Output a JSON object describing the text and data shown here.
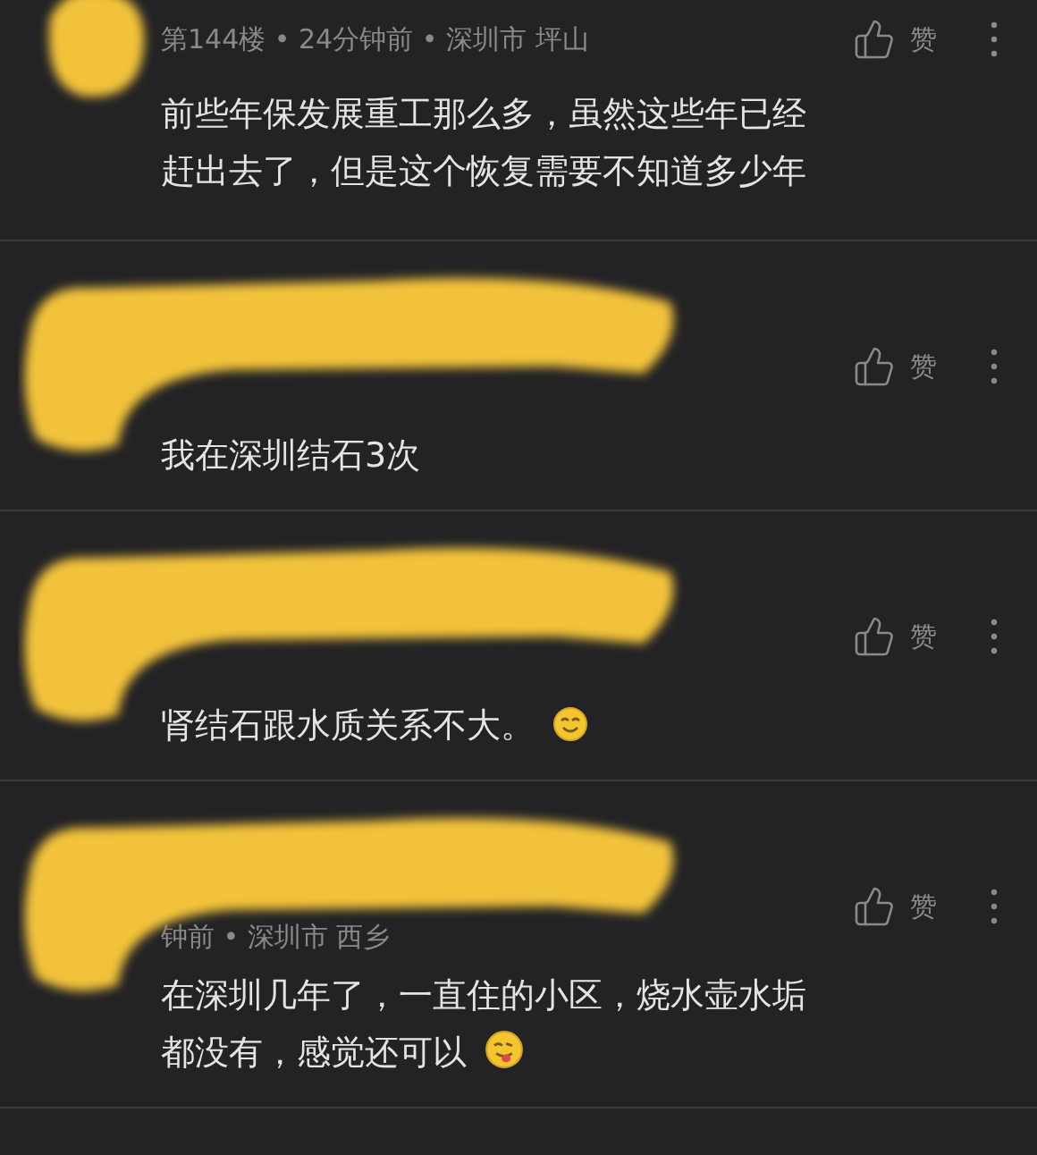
{
  "comments": [
    {
      "kind": "avatar",
      "meta": "第144楼 • 24分钟前 • 深圳市 坪山",
      "like": "赞",
      "body": "前些年保发展重工那么多，虽然这些年已经赶出去了，但是这个恢复需要不知道多少年"
    },
    {
      "kind": "avatar-name",
      "like": "赞",
      "body": "我在深圳结石3次"
    },
    {
      "kind": "avatar-name",
      "like": "赞",
      "body": "肾结石跟水质关系不大。",
      "emoji": {
        "kind": "smile"
      }
    },
    {
      "kind": "avatar-name",
      "meta": "钟前 • 深圳市 西乡",
      "like": "赞",
      "body": "在深圳几年了，一直住的小区，烧水壶水垢都没有，感觉还可以",
      "emoji": {
        "kind": "tongue"
      }
    }
  ]
}
